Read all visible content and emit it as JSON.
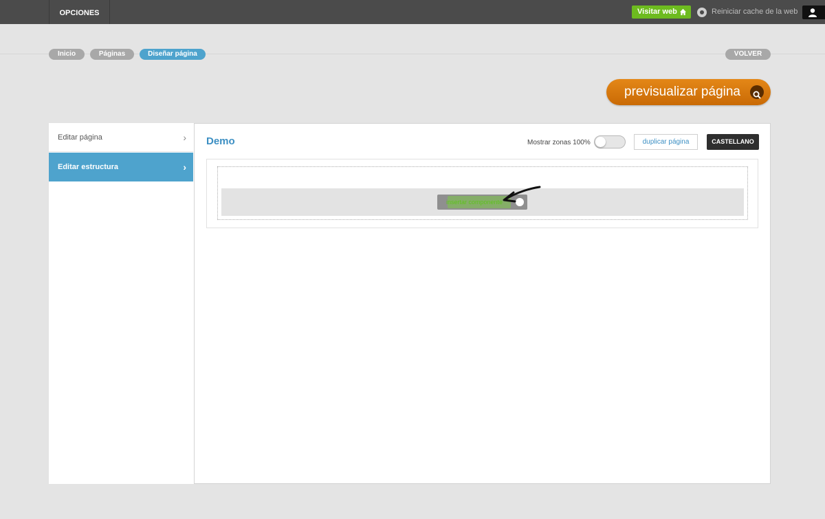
{
  "topbar": {
    "tab_label": "OPCIONES",
    "visit_label": "Visitar web",
    "cache_label": "Reiniciar cache de la web"
  },
  "breadcrumb": {
    "items": [
      "Inicio",
      "Páginas",
      "Diseñar página"
    ],
    "back_label": "VOLVER"
  },
  "preview": {
    "label": "previsualizar página"
  },
  "sidebar": {
    "items": [
      {
        "label": "Editar página"
      },
      {
        "label": "Editar estructura"
      }
    ]
  },
  "main": {
    "title": "Demo",
    "zones_label": "Mostrar zonas 100%",
    "duplicate_label": "duplicar página",
    "language_label": "CASTELLANO",
    "insert_label": "insertar componente"
  },
  "colors": {
    "topbar": "#4b4b4b",
    "accent_blue": "#4ea3cd",
    "visit_green": "#6dbb1f",
    "preview_orange": "#e48717"
  }
}
